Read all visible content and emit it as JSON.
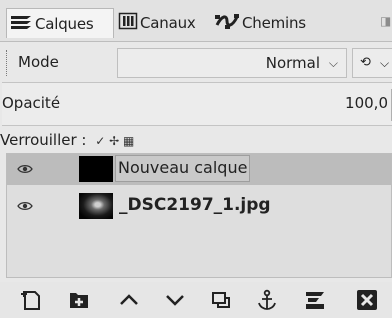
{
  "tabs": [
    {
      "label": "Calques",
      "icon": "layers-icon",
      "active": true
    },
    {
      "label": "Canaux",
      "icon": "channels-icon",
      "active": false
    },
    {
      "label": "Chemins",
      "icon": "paths-icon",
      "active": false
    }
  ],
  "mode": {
    "label": "Mode",
    "value": "Normal"
  },
  "opacity": {
    "label": "Opacité",
    "value": "100,0"
  },
  "lock": {
    "label": "Verrouiller :",
    "icons": "✓ ✢ ▦"
  },
  "layers": [
    {
      "name": "Nouveau calque",
      "visible": true,
      "selected": true,
      "thumb": "black"
    },
    {
      "name": "_DSC2197_1.jpg",
      "visible": true,
      "selected": false,
      "thumb": "photo"
    }
  ],
  "toolbar_icons": [
    "new-layer-icon",
    "new-layer-group-icon",
    "raise-layer-icon",
    "lower-layer-icon",
    "duplicate-layer-icon",
    "anchor-icon",
    "merge-down-icon",
    "delete-layer-icon"
  ],
  "colors": {
    "accent": "#2b2b2b",
    "selected_row": "#bcbcbc",
    "panel_bg": "#e8e8e8"
  }
}
